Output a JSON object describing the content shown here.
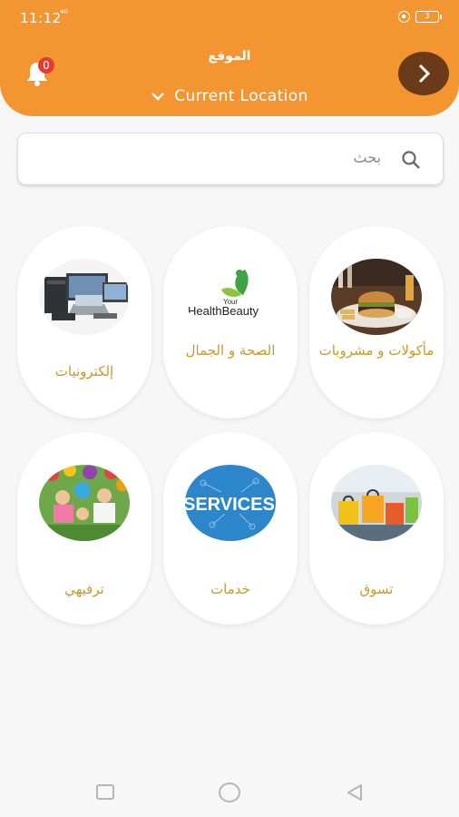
{
  "status_bar": {
    "time": "11:12",
    "signal": "⁴ᴳ",
    "battery": "3"
  },
  "header": {
    "notification_count": "0",
    "location_label": "الموقع",
    "current_location": "Current Location",
    "brand_color": "#f39530",
    "next_button_color": "#6b3a19"
  },
  "search": {
    "placeholder": "بحث"
  },
  "categories": [
    {
      "label": "مأكولات و مشروبات",
      "image": "food-burger-image"
    },
    {
      "label": "الصحة و الجمال",
      "image": "health-beauty-logo",
      "image_text_top": "Your",
      "image_text_main": "HealthBeauty"
    },
    {
      "label": "إلكترونيات",
      "image": "electronics-devices-image"
    },
    {
      "label": "تسوق",
      "image": "shopping-bags-image"
    },
    {
      "label": "خدمات",
      "image": "services-image",
      "image_text": "SERVICES"
    },
    {
      "label": "ترفيهي",
      "image": "kids-entertainment-image"
    }
  ],
  "label_color": "#c99a2b"
}
